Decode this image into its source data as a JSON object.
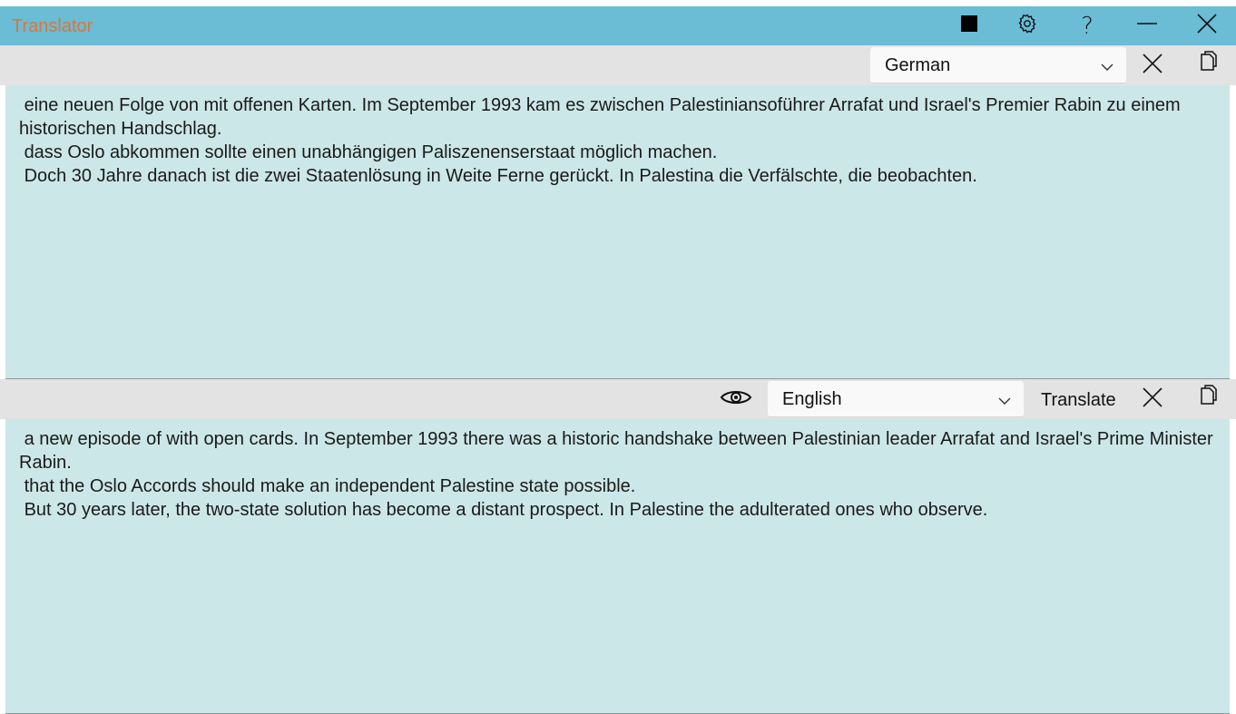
{
  "window": {
    "title": "Translator",
    "controls": {
      "stop": "stop-icon",
      "settings": "gear-icon",
      "help": "?",
      "minimize": "minimize-icon",
      "close": "close-icon"
    }
  },
  "source": {
    "language": "German",
    "lines": [
      " eine neuen Folge von mit offenen Karten. Im September 1993 kam es zwischen Palestiniansoführer Arrafat und Israel's Premier Rabin zu einem historischen Handschlag.",
      " dass Oslo abkommen sollte einen unabhängigen Paliszenenserstaat möglich machen.",
      " Doch 30 Jahre danach ist die zwei Staatenlösung in Weite Ferne gerückt. In Palestina die Verfälschte, die beobachten."
    ]
  },
  "target": {
    "language": "English",
    "translate_label": "Translate",
    "lines": [
      " a new episode of with open cards. In September 1993 there was a historic handshake between Palestinian leader Arrafat and Israel's Prime Minister Rabin.",
      " that the Oslo Accords should make an independent Palestine state possible.",
      " But 30 years later, the two-state solution has become a distant prospect. In Palestine the adulterated ones who observe."
    ]
  },
  "colors": {
    "titlebar": "#6bbcd5",
    "title_text": "#d9773a",
    "toolbar": "#e3e3e3",
    "text_pane": "#cce7e7"
  }
}
